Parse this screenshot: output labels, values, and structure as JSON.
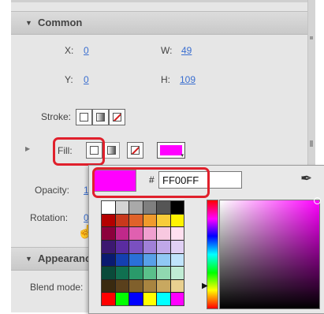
{
  "panel": {
    "section_common": "Common",
    "x_label": "X:",
    "x_value": "0",
    "w_label": "W:",
    "w_value": "49",
    "y_label": "Y:",
    "y_value": "0",
    "h_label": "H:",
    "h_value": "109",
    "stroke_label": "Stroke:",
    "fill_label": "Fill:",
    "opacity_label": "Opacity:",
    "opacity_value": "1(",
    "rotation_label": "Rotation:",
    "rotation_value": "0",
    "section_appearance": "Appearanc",
    "blend_mode_label": "Blend mode:"
  },
  "color_popup": {
    "hash": "#",
    "hex_value": "FF00FF",
    "current_color": "#ff00ff",
    "swatches": [
      "#ffffff",
      "#d4d4d4",
      "#a9a9a9",
      "#7f7f7f",
      "#555555",
      "#000000",
      "#b40000",
      "#c8381c",
      "#e0622a",
      "#f09a2c",
      "#f8cc3a",
      "#fff200",
      "#8c003c",
      "#c0288a",
      "#e060b0",
      "#f0a0d0",
      "#f8c8e0",
      "#ffe0f0",
      "#3c1870",
      "#5a2ca0",
      "#7a50c0",
      "#a080d8",
      "#c0a8e8",
      "#e0d0f4",
      "#0a1a70",
      "#1440b0",
      "#2a70d8",
      "#58a0e8",
      "#90c8f4",
      "#c0e4fc",
      "#0a4a3a",
      "#107050",
      "#2a9a6a",
      "#5ac08a",
      "#90d8b0",
      "#c0ecd4",
      "#3a2a10",
      "#5a401c",
      "#80602c",
      "#a88440",
      "#c8a860",
      "#e8d090",
      "#ff0000",
      "#00ff00",
      "#0000ff",
      "#ffff00",
      "#00ffff",
      "#ff00ff"
    ]
  }
}
